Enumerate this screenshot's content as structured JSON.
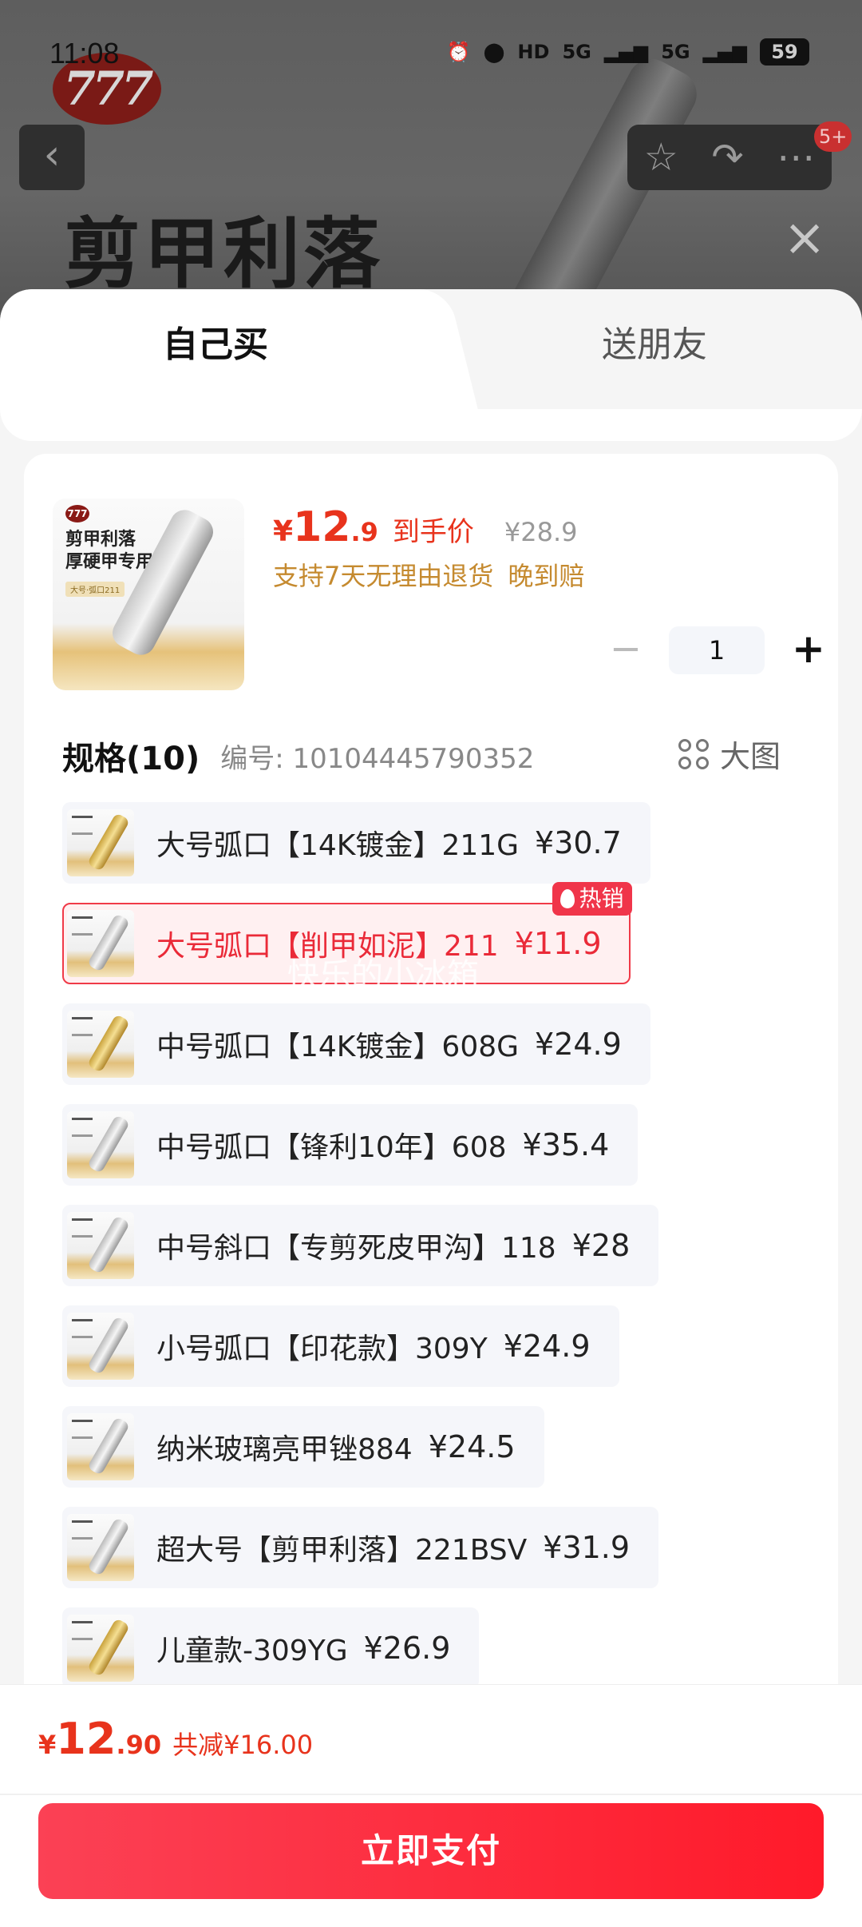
{
  "status_bar": {
    "time": "11:08",
    "network": "HD",
    "signal1": "5G",
    "signal2": "5G",
    "battery": "59"
  },
  "background": {
    "product_title": "剪甲利落",
    "brand_logo_text": "777",
    "cart_badge": "5+"
  },
  "tabs": {
    "self_buy": "自己买",
    "gift": "送朋友"
  },
  "product": {
    "thumb_title_line1": "剪甲利落",
    "thumb_title_line2": "厚硬甲专用",
    "thumb_tag": "大号·弧口211",
    "price_currency": "¥",
    "price_int": "12",
    "price_dec": ".9",
    "price_tag": "到手价",
    "original_price": "¥28.9",
    "service1": "支持7天无理由退货",
    "service2": "晚到赔",
    "quantity": "1"
  },
  "spec": {
    "title": "规格(10)",
    "code": "编号: 10104445790352",
    "big_image_label": "大图",
    "hot_label": "热销",
    "watermark": "快乐的小冰箱",
    "items": [
      {
        "label": "大号弧口【14K镀金】211G",
        "price": "¥30.7"
      },
      {
        "label": "大号弧口【削甲如泥】211",
        "price": "¥11.9"
      },
      {
        "label": "中号弧口【14K镀金】608G",
        "price": "¥24.9"
      },
      {
        "label": "中号弧口【锋利10年】608",
        "price": "¥35.4"
      },
      {
        "label": "中号斜口【专剪死皮甲沟】118",
        "price": "¥28"
      },
      {
        "label": "小号弧口【印花款】309Y",
        "price": "¥24.9"
      },
      {
        "label": "纳米玻璃亮甲锉884",
        "price": "¥24.5"
      },
      {
        "label": "超大号【剪甲利落】221BSV",
        "price": "¥31.9"
      },
      {
        "label": "儿童款-309YG",
        "price": "¥26.9"
      }
    ],
    "selected_index": 1
  },
  "footer": {
    "currency": "¥",
    "total_int": "12",
    "total_dec": ".90",
    "discount": "共减¥16.00",
    "pay_label": "立即支付"
  },
  "colors": {
    "accent_red": "#e8331c",
    "pay_button": "#ff1a2a",
    "service_gold": "#c58a2f"
  }
}
